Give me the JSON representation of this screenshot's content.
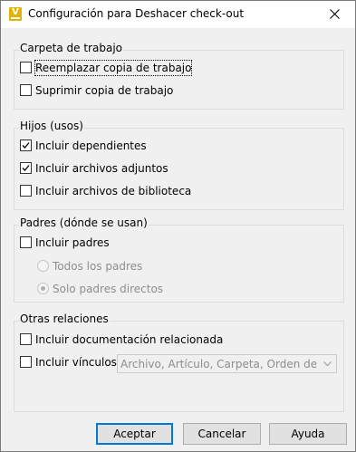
{
  "window": {
    "title": "Configuración para Deshacer check-out"
  },
  "icons": {
    "app": "vault-app-icon",
    "close": "close-icon"
  },
  "groups": {
    "workspace": {
      "label": "Carpeta de trabajo",
      "options": [
        {
          "label": "Reemplazar copia de trabajo",
          "checked": false
        },
        {
          "label": "Suprimir copia de trabajo",
          "checked": false
        }
      ]
    },
    "children": {
      "label": "Hijos (usos)",
      "options": [
        {
          "label": "Incluir dependientes",
          "checked": true
        },
        {
          "label": "Incluir archivos adjuntos",
          "checked": true
        },
        {
          "label": "Incluir archivos de biblioteca",
          "checked": false
        }
      ]
    },
    "parents": {
      "label": "Padres (dónde se usan)",
      "include_label": "Incluir padres",
      "include_checked": false,
      "radios": [
        {
          "label": "Todos los padres",
          "selected": false
        },
        {
          "label": "Solo padres directos",
          "selected": true
        }
      ]
    },
    "other": {
      "label": "Otras relaciones",
      "options": [
        {
          "label": "Incluir documentación relacionada",
          "checked": false
        },
        {
          "label": "Incluir vínculos",
          "checked": false
        }
      ],
      "links_combo_value": "Archivo, Artículo, Carpeta, Orden de ca..."
    }
  },
  "buttons": {
    "accept": "Aceptar",
    "cancel": "Cancelar",
    "help": "Ayuda"
  }
}
